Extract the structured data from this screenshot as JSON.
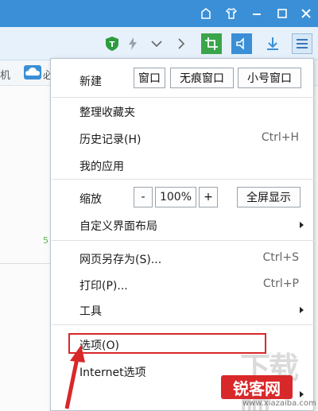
{
  "titlebar": {
    "icons": [
      "skin-icon",
      "shirt-icon",
      "minimize-icon",
      "restore-icon",
      "close-icon"
    ]
  },
  "toolbar": {
    "icons": [
      "shield-icon",
      "lightning-icon",
      "chevron-down-icon",
      "chevron-right-icon",
      "crop-icon",
      "sound-icon",
      "download-icon",
      "menu-icon"
    ]
  },
  "background": {
    "bookmark_text": "机",
    "bookmark_text2": "必",
    "green_text": "5"
  },
  "menu": {
    "new_label": "新建",
    "new_window": "窗口",
    "incognito_window": "无痕窗口",
    "small_window": "小号窗口",
    "organize_favorites": "整理收藏夹",
    "history": "历史记录(H)",
    "history_shortcut": "Ctrl+H",
    "my_apps": "我的应用",
    "zoom_label": "缩放",
    "zoom_minus": "-",
    "zoom_value": "100%",
    "zoom_plus": "+",
    "fullscreen": "全屏显示",
    "custom_layout": "自定义界面布局",
    "save_as": "网页另存为(S)...",
    "save_shortcut": "Ctrl+S",
    "print": "打印(P)...",
    "print_shortcut": "Ctrl+P",
    "tools": "工具",
    "options": "选项(O)",
    "internet_options": "Internet选项"
  },
  "watermark": {
    "big": "下载吧",
    "red": "锐客网",
    "url": "www.xiazaiba.com"
  },
  "colors": {
    "titlebar": "#3a8fd6",
    "highlight": "#d8282a"
  }
}
